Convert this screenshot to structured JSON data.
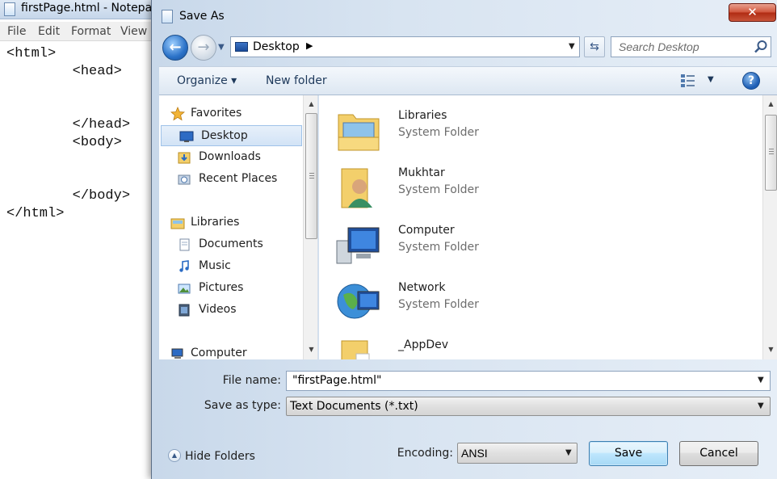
{
  "notepad": {
    "title": "firstPage.html - Notepad",
    "menu": [
      "File",
      "Edit",
      "Format",
      "View"
    ],
    "content": "<html>\n        <head>\n\n\n        </head>\n        <body>\n\n\n        </body>\n</html>"
  },
  "dialog": {
    "title": "Save As",
    "close_label": "✕",
    "address": {
      "location": "Desktop"
    },
    "search": {
      "placeholder": "Search Desktop"
    },
    "toolbar": {
      "organize": "Organize ▾",
      "new_folder": "New folder"
    },
    "nav": {
      "favorites": "Favorites",
      "favorite_items": [
        "Desktop",
        "Downloads",
        "Recent Places"
      ],
      "libraries": "Libraries",
      "library_items": [
        "Documents",
        "Music",
        "Pictures",
        "Videos"
      ],
      "computer": "Computer"
    },
    "files": [
      {
        "name": "Libraries",
        "type": "System Folder"
      },
      {
        "name": "Mukhtar",
        "type": "System Folder"
      },
      {
        "name": "Computer",
        "type": "System Folder"
      },
      {
        "name": "Network",
        "type": "System Folder"
      },
      {
        "name": "_AppDev",
        "type": ""
      }
    ],
    "form": {
      "file_name_label": "File name:",
      "file_name_value": "\"firstPage.html\"",
      "save_type_label": "Save as type:",
      "save_type_value": "Text Documents (*.txt)",
      "encoding_label": "Encoding:",
      "encoding_value": "ANSI",
      "hide_folders": "Hide Folders",
      "save": "Save",
      "cancel": "Cancel"
    }
  },
  "colors": {
    "accent": "#2b72c8",
    "close": "#c9553a",
    "title_bar": "#c8d8ea"
  },
  "icons": [
    "notepad-icon",
    "back-arrow-icon",
    "forward-arrow-icon",
    "desktop-icon",
    "refresh-icon",
    "search-icon",
    "views-icon",
    "help-icon",
    "star-icon",
    "folder-icon",
    "user-icon",
    "computer-icon",
    "network-icon",
    "library-icon",
    "music-icon",
    "pictures-icon",
    "videos-icon"
  ]
}
